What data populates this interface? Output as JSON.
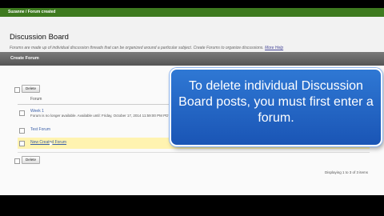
{
  "breadcrumb": "Suzanne / Forum created",
  "page": {
    "title": "Discussion Board",
    "description": "Forums are made up of individual discussion threads that can be organized around a particular subject. Create Forums to organize discussions.",
    "more_help": "More Help"
  },
  "action_bar": {
    "create_forum_label": "Create Forum"
  },
  "table": {
    "delete_label": "Delete",
    "column_header": "Forum",
    "rows": [
      {
        "title": "Week 1",
        "meta": "Forum is no longer available. Available until: Friday, October 17, 2014 11:59:00 PM PDT"
      },
      {
        "title": "Test Forum",
        "meta": ""
      },
      {
        "title": "New Created Forum",
        "meta": ""
      }
    ],
    "display_info": "Displaying 1 to 3 of 3 items"
  },
  "callout": {
    "text": "To delete individual Discussion Board posts, you must first enter a forum."
  },
  "colors": {
    "status_green": "#3e7a1f",
    "callout_blue": "#2663c6",
    "highlight": "#fff3b0"
  }
}
